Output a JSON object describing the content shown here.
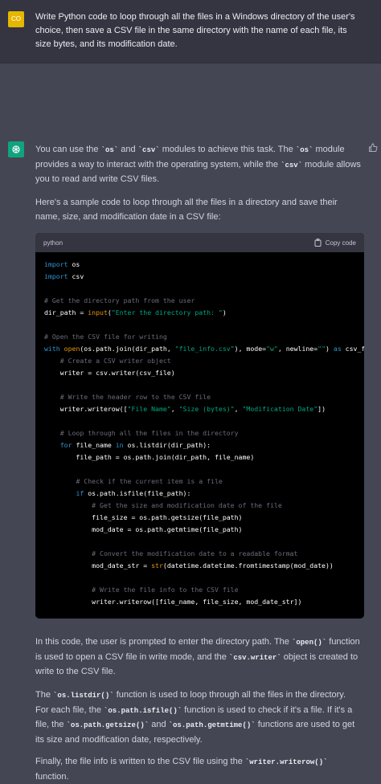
{
  "user": {
    "avatar_initials": "CO",
    "message": "Write Python code to loop through all the files in a Windows directory of the user's choice, then save a CSV file in the same directory with the name of each file, its size bytes, and its modification date."
  },
  "assistant": {
    "intro": {
      "p1": "You can use the ",
      "c1": "`os`",
      "p2": " and ",
      "c2": "`csv`",
      "p3": " modules to achieve this task. The ",
      "c3": "`os`",
      "p4": " module provides a way to interact with the operating system, while the ",
      "c4": "`csv`",
      "p5": " module allows you to read and write CSV files."
    },
    "sample_intro": "Here's a sample code to loop through all the files in a directory and save their name, size, and modification date in a CSV file:",
    "code_block": {
      "language": "python",
      "copy_label": "Copy code",
      "lines": [
        "import os",
        "import csv",
        "",
        "# Get the directory path from the user",
        "dir_path = input(\"Enter the directory path: \")",
        "",
        "# Open the CSV file for writing",
        "with open(os.path.join(dir_path, \"file_info.csv\"), mode=\"w\", newline=\"\") as csv_fil",
        "    # Create a CSV writer object",
        "    writer = csv.writer(csv_file)",
        "",
        "    # Write the header row to the CSV file",
        "    writer.writerow([\"File Name\", \"Size (bytes)\", \"Modification Date\"])",
        "",
        "    # Loop through all the files in the directory",
        "    for file_name in os.listdir(dir_path):",
        "        file_path = os.path.join(dir_path, file_name)",
        "",
        "        # Check if the current item is a file",
        "        if os.path.isfile(file_path):",
        "            # Get the size and modification date of the file",
        "            file_size = os.path.getsize(file_path)",
        "            mod_date = os.path.getmtime(file_path)",
        "",
        "            # Convert the modification date to a readable format",
        "            mod_date_str = str(datetime.datetime.fromtimestamp(mod_date))",
        "",
        "            # Write the file info to the CSV file",
        "            writer.writerow([file_name, file_size, mod_date_str])"
      ]
    },
    "explain1": {
      "p1": "In this code, the user is prompted to enter the directory path. The ",
      "c1": "`open()`",
      "p2": " function is used to open a CSV file in write mode, and the ",
      "c2": "`csv.writer`",
      "p3": " object is created to write to the CSV file."
    },
    "explain2": {
      "p1": "The ",
      "c1": "`os.listdir()`",
      "p2": " function is used to loop through all the files in the directory. For each file, the ",
      "c2": "`os.path.isfile()`",
      "p3": " function is used to check if it's a file. If it's a file, the ",
      "c3": "`os.path.getsize()`",
      "p4": " and ",
      "c4": "`os.path.getmtime()`",
      "p5": " functions are used to get its size and modification date, respectively."
    },
    "explain3": {
      "p1": "Finally, the file info is written to the CSV file using the ",
      "c1": "`writer.writerow()`",
      "p2": " function."
    }
  },
  "colors": {
    "user_bg": "#343541",
    "assistant_bg": "#444654",
    "user_avatar": "#e5b700",
    "gpt_avatar": "#10a37f",
    "code_bg": "#000000",
    "keyword": "#2e95d3",
    "string": "#00a67d",
    "comment": "#6b6b7b"
  }
}
